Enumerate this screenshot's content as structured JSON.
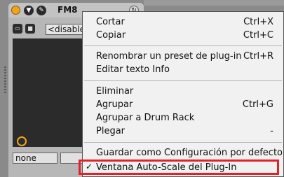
{
  "device": {
    "name": "FM8",
    "preset_value": "<disable",
    "bottom_value": "none"
  },
  "icons": {
    "power": "power-icon",
    "hotswap": "hotswap-icon",
    "wrench": "wrench-icon",
    "refresh": "refresh-icon",
    "folder": "folder-icon",
    "save": "save-icon"
  },
  "colors": {
    "accent": "#f3a21f",
    "highlight": "#e6202a"
  },
  "menu": {
    "cut": {
      "label": "Cortar",
      "shortcut": "Ctrl+X"
    },
    "copy": {
      "label": "Copiar",
      "shortcut": "Ctrl+C"
    },
    "rename": {
      "label": "Renombrar un preset de plug-in",
      "shortcut": "Ctrl+R"
    },
    "edit_info": {
      "label": "Editar texto Info"
    },
    "delete": {
      "label": "Eliminar"
    },
    "group": {
      "label": "Agrupar",
      "shortcut": "Ctrl+G"
    },
    "group_drum": {
      "label": "Agrupar a Drum Rack"
    },
    "fold": {
      "label": "Plegar",
      "shortcut": "-"
    },
    "save_default": {
      "label": "Guardar como Configuración por defecto"
    },
    "autoscale": {
      "label": "Ventana Auto-Scale del Plug-In",
      "check": "✓"
    }
  }
}
